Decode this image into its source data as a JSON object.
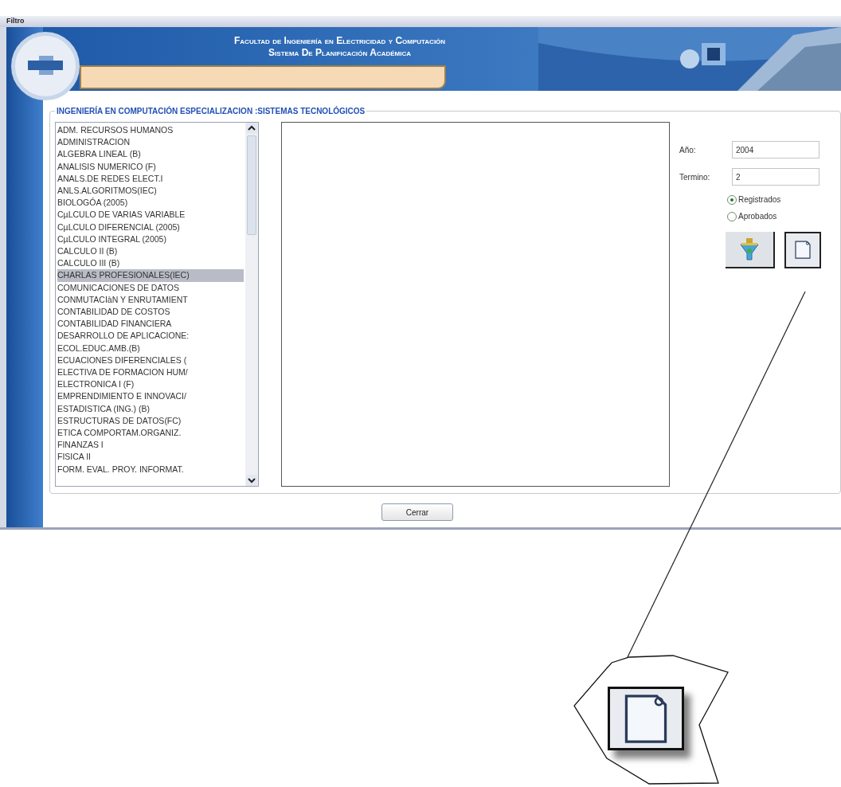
{
  "window": {
    "title": "Filtro"
  },
  "banner": {
    "line_1": "Facultad de Ingeniería en Electricidad y Computación",
    "line_2": "Sistema De Planificación Académica"
  },
  "group": {
    "legend": "INGENIERÍA EN COMPUTACIÓN ESPECIALIZACION :SISTEMAS TECNOLÓGICOS"
  },
  "subjects": [
    {
      "label": "ADM. RECURSOS HUMANOS",
      "selected": false
    },
    {
      "label": "ADMINISTRACION",
      "selected": false
    },
    {
      "label": "ALGEBRA LINEAL (B)",
      "selected": false
    },
    {
      "label": "ANALISIS NUMERICO (F)",
      "selected": false
    },
    {
      "label": "ANALS.DE REDES ELECT.I",
      "selected": false
    },
    {
      "label": "ANLS.ALGORITMOS(IEC)",
      "selected": false
    },
    {
      "label": "BIOLOGÓA (2005)",
      "selected": false
    },
    {
      "label": "CµLCULO DE VARIAS VARIABLE",
      "selected": false
    },
    {
      "label": "CµLCULO DIFERENCIAL (2005)",
      "selected": false
    },
    {
      "label": "CµLCULO INTEGRAL (2005)",
      "selected": false
    },
    {
      "label": "CALCULO II (B)",
      "selected": false
    },
    {
      "label": "CALCULO III (B)",
      "selected": false
    },
    {
      "label": "CHARLAS PROFESIONALES(IEC)",
      "selected": true
    },
    {
      "label": "COMUNICACIONES DE DATOS",
      "selected": false
    },
    {
      "label": "CONMUTACIàN Y ENRUTAMIENT",
      "selected": false
    },
    {
      "label": "CONTABILIDAD DE COSTOS",
      "selected": false
    },
    {
      "label": "CONTABILIDAD FINANCIERA",
      "selected": false
    },
    {
      "label": "DESARROLLO DE APLICACIONE:",
      "selected": false
    },
    {
      "label": "ECOL.EDUC.AMB.(B)",
      "selected": false
    },
    {
      "label": "ECUACIONES DIFERENCIALES (",
      "selected": false
    },
    {
      "label": "ELECTIVA DE FORMACION HUM/",
      "selected": false
    },
    {
      "label": "ELECTRONICA I (F)",
      "selected": false
    },
    {
      "label": "EMPRENDIMIENTO E INNOVACI/",
      "selected": false
    },
    {
      "label": "ESTADISTICA (ING.) (B)",
      "selected": false
    },
    {
      "label": "ESTRUCTURAS DE DATOS(FC)",
      "selected": false
    },
    {
      "label": "ETICA COMPORTAM.ORGANIZ.",
      "selected": false
    },
    {
      "label": "FINANZAS I",
      "selected": false
    },
    {
      "label": "FISICA II",
      "selected": false
    },
    {
      "label": "FORM. EVAL. PROY. INFORMAT.",
      "selected": false
    }
  ],
  "fields": [
    {
      "label": "Año:",
      "value": "2004"
    },
    {
      "label": "Termino:",
      "value": "2"
    }
  ],
  "options": [
    {
      "label": "Registrados",
      "selected": true
    },
    {
      "label": "Aprobados",
      "selected": false
    }
  ],
  "close_button": "Cerrar"
}
